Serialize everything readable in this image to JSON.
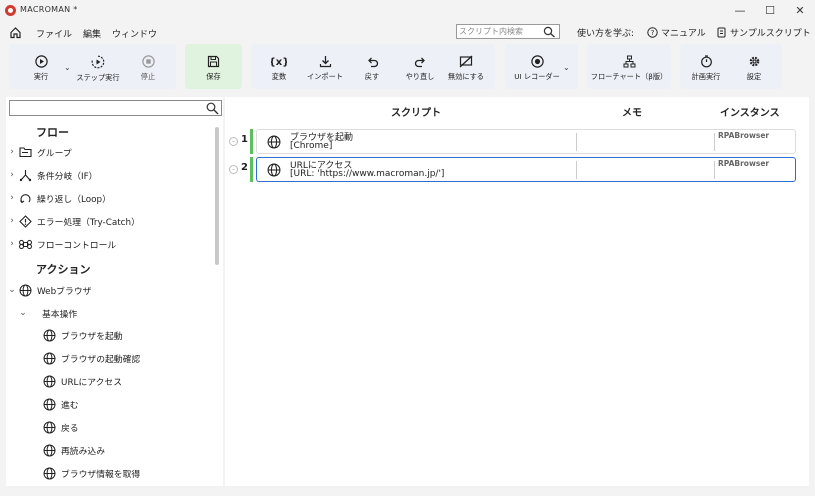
{
  "window": {
    "title": "MACROMAN *",
    "minimize": "—",
    "maximize": "☐",
    "close": "✕"
  },
  "menu": {
    "items": [
      "ファイル",
      "編集",
      "ウィンドウ"
    ],
    "search_placeholder": "スクリプト内検索",
    "help_label": "使い方を学ぶ:",
    "manual_label": "マニュアル",
    "samples_label": "サンプルスクリプト"
  },
  "ribbon": {
    "run": "実行",
    "step_run": "ステップ実行",
    "stop": "停止",
    "save": "保存",
    "variables": "変数",
    "import": "インポート",
    "undo": "戻す",
    "redo": "やり直し",
    "disable": "無効にする",
    "ui_recorder": "UI レコーダー",
    "flowchart": "フローチャート（β版）",
    "scheduled_run": "計画実行",
    "settings": "設定"
  },
  "tree": {
    "flow_header": "フロー",
    "flow_items": [
      "グループ",
      "条件分岐（IF）",
      "繰り返し（Loop）",
      "エラー処理（Try-Catch）",
      "フローコントロール"
    ],
    "action_header": "アクション",
    "web_browser": "Webブラウザ",
    "basic_ops": "基本操作",
    "actions": [
      "ブラウザを起動",
      "ブラウザの起動確認",
      "URLにアクセス",
      "進む",
      "戻る",
      "再読み込み",
      "ブラウザ情報を取得"
    ]
  },
  "script": {
    "col_script": "スクリプト",
    "col_memo": "メモ",
    "col_instance": "インスタンス",
    "steps": [
      {
        "num": "1",
        "title": "ブラウザを起動",
        "param": "[Chrome]",
        "instance": "RPABrowser",
        "selected": false
      },
      {
        "num": "2",
        "title": "URLにアクセス",
        "param": "[URL: 'https://www.macroman.jp/']",
        "instance": "RPABrowser",
        "selected": true
      }
    ]
  },
  "colors": {
    "accent": "#2b6fd6",
    "step_bar": "#5bbf5b",
    "save_group_bg": "#dff3df",
    "ribbon_bg": "#eef0f8",
    "logo": "#d23a2e"
  }
}
